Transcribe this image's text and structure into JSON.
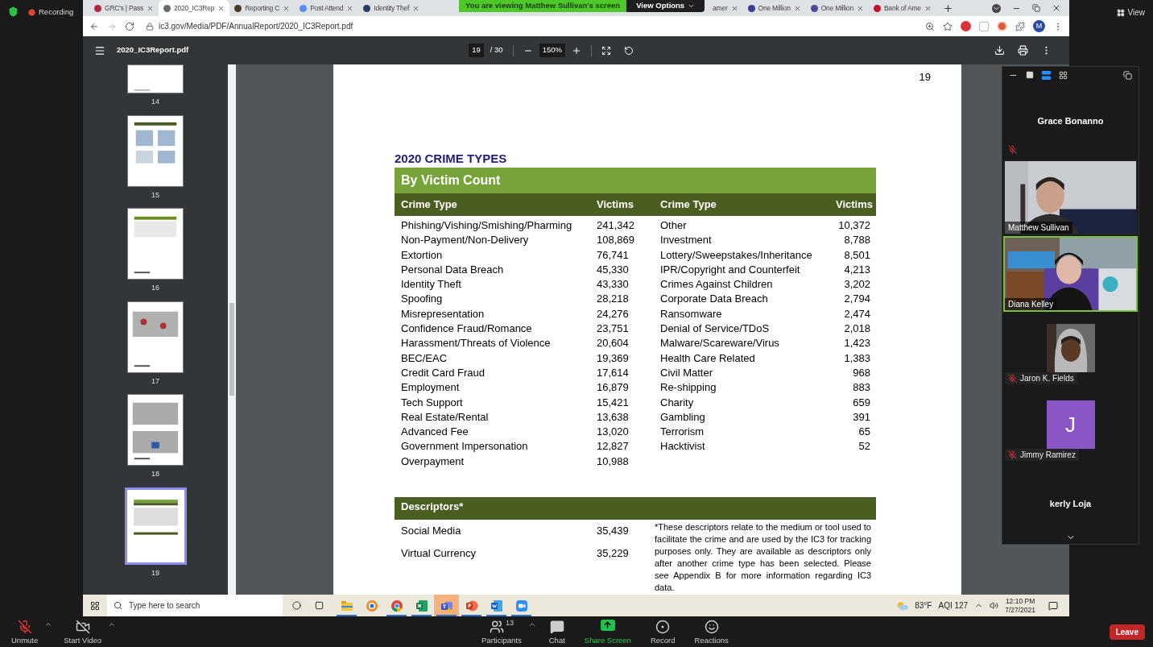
{
  "zoom_top": {
    "recording": "Recording",
    "view": "View"
  },
  "banner": {
    "text": "You are viewing Matthew Sullivan's screen",
    "options": "View Options"
  },
  "browser": {
    "tabs": [
      {
        "title": "GRC's | Pass",
        "selected": false,
        "color": "#b5263a"
      },
      {
        "title": "2020_IC3Rep",
        "selected": true,
        "color": "#6b6b6b"
      },
      {
        "title": "Reporting C",
        "selected": false,
        "color": "#4a3b1f"
      },
      {
        "title": "Post Attend",
        "selected": false,
        "color": "#5b8def"
      },
      {
        "title": "Identity Thef",
        "selected": false,
        "color": "#2b3a67"
      },
      {
        "title": "amer",
        "selected": false
      },
      {
        "title": "One Million",
        "selected": false,
        "color": "#3d3d8f"
      },
      {
        "title": "One Million",
        "selected": false,
        "color": "#4a4aa0"
      },
      {
        "title": "Bank of Ame",
        "selected": false,
        "color": "#c8102e"
      }
    ],
    "address": "ic3.gov/Media/PDF/AnnualReport/2020_IC3Report.pdf",
    "avatar": "M"
  },
  "pdf": {
    "file": "2020_IC3Report.pdf",
    "page": "19",
    "total": "/ 30",
    "zoom": "150%"
  },
  "thumbnails": [
    {
      "label": "14",
      "selected": false
    },
    {
      "label": "15",
      "selected": false
    },
    {
      "label": "16",
      "selected": false
    },
    {
      "label": "17",
      "selected": false
    },
    {
      "label": "18",
      "selected": false
    },
    {
      "label": "19",
      "selected": true
    }
  ],
  "page": {
    "number": "19",
    "title": "2020 CRIME TYPES",
    "subtitle": "By Victim Count",
    "columns": [
      "Crime Type",
      "Victims",
      "Crime Type",
      "Victims"
    ],
    "rows": [
      [
        "Phishing/Vishing/Smishing/Pharming",
        "241,342",
        "Other",
        "10,372"
      ],
      [
        "Non-Payment/Non-Delivery",
        "108,869",
        "Investment",
        "8,788"
      ],
      [
        "Extortion",
        "76,741",
        "Lottery/Sweepstakes/Inheritance",
        "8,501"
      ],
      [
        "Personal Data Breach",
        "45,330",
        "IPR/Copyright and Counterfeit",
        "4,213"
      ],
      [
        "Identity Theft",
        "43,330",
        "Crimes Against Children",
        "3,202"
      ],
      [
        "Spoofing",
        "28,218",
        "Corporate Data Breach",
        "2,794"
      ],
      [
        "Misrepresentation",
        "24,276",
        "Ransomware",
        "2,474"
      ],
      [
        "Confidence Fraud/Romance",
        "23,751",
        "Denial of Service/TDoS",
        "2,018"
      ],
      [
        "Harassment/Threats of Violence",
        "20,604",
        "Malware/Scareware/Virus",
        "1,423"
      ],
      [
        "BEC/EAC",
        "19,369",
        "Health Care Related",
        "1,383"
      ],
      [
        "Credit Card Fraud",
        "17,614",
        "Civil Matter",
        "968"
      ],
      [
        "Employment",
        "16,879",
        "Re-shipping",
        "883"
      ],
      [
        "Tech Support",
        "15,421",
        "Charity",
        "659"
      ],
      [
        "Real Estate/Rental",
        "13,638",
        "Gambling",
        "391"
      ],
      [
        "Advanced Fee",
        "13,020",
        "Terrorism",
        "65"
      ],
      [
        "Government Impersonation",
        "12,827",
        "Hacktivist",
        "52"
      ],
      [
        "Overpayment",
        "10,988"
      ]
    ],
    "descriptors": {
      "title": "Descriptors*",
      "rows": [
        [
          "Social Media",
          "35,439"
        ],
        [
          "Virtual Currency",
          "35,229"
        ]
      ],
      "note": "*These descriptors relate to the medium or tool used to facilitate the crime and are used by the IC3 for tracking purposes only. They are available as descriptors only after another crime type has been selected. Please see Appendix B for more information regarding IC3 data."
    }
  },
  "taskbar": {
    "search_placeholder": "Type here to search",
    "apps": [
      {
        "kind": "explorer",
        "running": true,
        "selected": false
      },
      {
        "kind": "browser",
        "running": false,
        "selected": false
      },
      {
        "kind": "chrome",
        "running": true,
        "selected": false
      },
      {
        "kind": "excel",
        "running": true,
        "selected": false
      },
      {
        "kind": "teams",
        "running": true,
        "selected": true
      },
      {
        "kind": "powerpoint",
        "running": true,
        "selected": false
      },
      {
        "kind": "word",
        "running": true,
        "selected": false
      },
      {
        "kind": "zoom",
        "running": true,
        "selected": false
      }
    ],
    "weather": "83°F",
    "aqi": "AQI 127",
    "time": "12:10 PM",
    "date": "7/27/2021"
  },
  "participants": [
    {
      "kind": "name",
      "name": "Grace Bonanno",
      "muted": true,
      "active": false
    },
    {
      "kind": "video",
      "name": "Matthew Sullivan",
      "muted": false,
      "active": false
    },
    {
      "kind": "video",
      "name": "Diana Kelley",
      "muted": false,
      "active": true
    },
    {
      "name": "Jaron K. Fields",
      "muted": true,
      "active": false
    },
    {
      "kind": "initial",
      "initial": "J",
      "name": "Jimmy Ramirez",
      "muted": true,
      "active": false
    },
    {
      "kind": "name",
      "name": "kerly Loja",
      "muted": false,
      "active": false
    }
  ],
  "controls": [
    {
      "kind": "mic",
      "label": "Unmute"
    },
    {
      "kind": "video",
      "label": "Start Video"
    },
    {
      "kind": "participants",
      "label": "Participants",
      "count": "13"
    },
    {
      "kind": "chat",
      "label": "Chat"
    },
    {
      "kind": "share",
      "label": "Share Screen"
    },
    {
      "kind": "record",
      "label": "Record"
    },
    {
      "kind": "reactions",
      "label": "Reactions"
    }
  ],
  "leave": "Leave"
}
